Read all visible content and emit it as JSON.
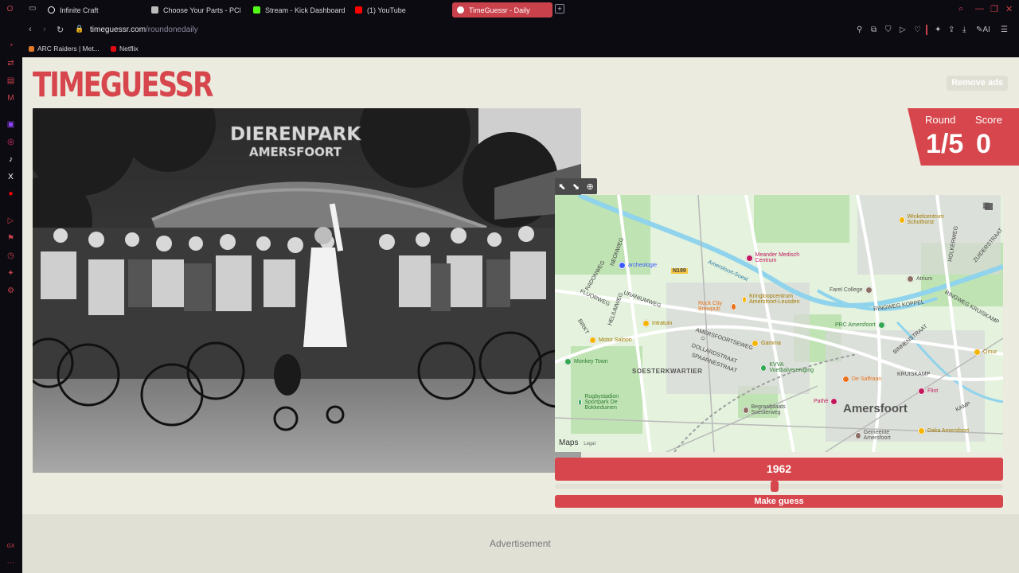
{
  "browser": {
    "tabs": [
      {
        "label": "Infinite Craft",
        "color": "#ffffff"
      },
      {
        "label": "Choose Your Parts - PCPa",
        "color": "#bbbbbb"
      },
      {
        "label": "Stream - Kick Dashboard",
        "color": "#53fc18"
      },
      {
        "label": "(1) YouTube",
        "color": "#ff0000"
      },
      {
        "label": "TimeGuessr - Daily",
        "color": "#ffffff"
      }
    ],
    "new_tab_label": "+",
    "url_host": "timeguessr.com",
    "url_path": "/roundonedaily",
    "bookmarks": [
      {
        "label": "ARC Raiders | Met...",
        "color": "#e07a2a"
      },
      {
        "label": "Netflix",
        "color": "#e50914"
      }
    ],
    "ai_label": "AI"
  },
  "page": {
    "logo": "TIMEGUESSR",
    "remove_ads": "Remove ads",
    "round_label": "Round",
    "round_value": "1/5",
    "score_label": "Score",
    "score_value": "0",
    "photo_sign_line1": "DIERENPARK",
    "photo_sign_line2": "AMERSFOORT",
    "map": {
      "city": "Amersfoort",
      "districts": [
        "SOESTERKWARTIER"
      ],
      "road_badge": "N199",
      "maps_brand": "Maps",
      "legal": "Legal",
      "streets": [
        "Amersfoort-Soest",
        "RINGWEG KOPPEL",
        "RINGWEG KRUISKAMP",
        "AMERSFOORTSEWEG",
        "DOLLARDSTRAAT",
        "SPAARNESTRAAT",
        "URANIUMWEG",
        "HELIUMWEG",
        "FLUORWEG",
        "NEONWEG",
        "RADONWEG",
        "KRUISKAMP",
        "KAMP",
        "BIRKT",
        "HOLKERWEG",
        "BINNENSTRAAT",
        "ZUIDERSTRAAT"
      ],
      "pois": [
        {
          "label": "Meander Medisch Centrum",
          "color": "#c2185b"
        },
        {
          "label": "archeologie",
          "color": "#3d5afe"
        },
        {
          "label": "Winkelcentrum Schothorst",
          "color": "#f4b400"
        },
        {
          "label": "Farel College",
          "color": "#8d6e63"
        },
        {
          "label": "Atrium",
          "color": "#8d6e63"
        },
        {
          "label": "Kringloopcentrum Amersfoort-Leusden",
          "color": "#f4b400"
        },
        {
          "label": "Rock City Brewpub",
          "color": "#e8711a"
        },
        {
          "label": "PRC Amersfoort",
          "color": "#34a853"
        },
        {
          "label": "Intratuin",
          "color": "#f4b400"
        },
        {
          "label": "Motor Saloon",
          "color": "#f4b400"
        },
        {
          "label": "Gamma",
          "color": "#f4b400"
        },
        {
          "label": "Monkey Town",
          "color": "#34a853"
        },
        {
          "label": "KVVA Voetbalvereniging",
          "color": "#34a853"
        },
        {
          "label": "De Saffraan",
          "color": "#e8711a"
        },
        {
          "label": "Flint",
          "color": "#c2185b"
        },
        {
          "label": "Rugbystadion Sportpark De Bokkeduinen",
          "color": "#34a853"
        },
        {
          "label": "Pathé",
          "color": "#c2185b"
        },
        {
          "label": "Begraafplaats Soesterweg",
          "color": "#8d6e63"
        },
        {
          "label": "Gemeente Amersfoort",
          "color": "#8d6e63"
        },
        {
          "label": "Daka Amersfoort",
          "color": "#f4b400"
        },
        {
          "label": "Omur",
          "color": "#f4b400"
        }
      ]
    },
    "year_value": "1962",
    "year_slider_fraction": 0.49,
    "make_guess": "Make guess",
    "advertisement": "Advertisement"
  },
  "colors": {
    "accent": "#d6464c",
    "page_bg": "#ecebe0",
    "chrome_bg": "#0d0b12"
  }
}
